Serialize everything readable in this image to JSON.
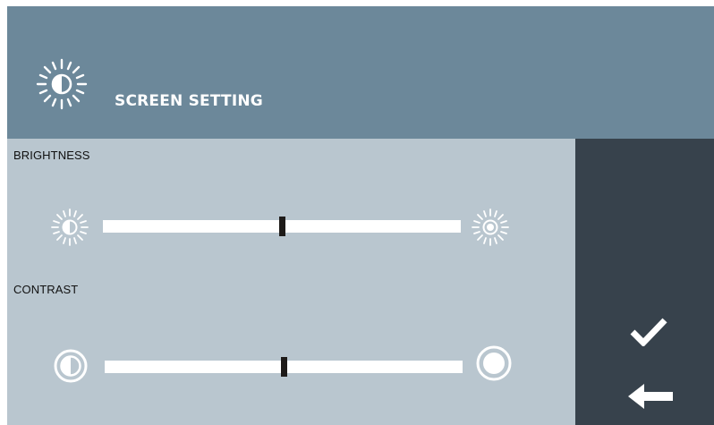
{
  "header": {
    "title": "SCREEN SETTING",
    "icon": "brightness-icon"
  },
  "brightness": {
    "label": "BRIGHTNESS",
    "level_percent": 50,
    "min_icon": "brightness-low-icon",
    "max_icon": "brightness-high-icon"
  },
  "contrast": {
    "label": "CONTRAST",
    "level_percent": 50,
    "min_icon": "contrast-low-icon",
    "max_icon": "contrast-high-icon"
  },
  "actions": {
    "confirm_icon": "checkmark-icon",
    "back_icon": "back-arrow-icon"
  },
  "colors": {
    "header_bg": "#6c889a",
    "content_bg": "#b9c6cf",
    "side_panel_bg": "#37424c",
    "track": "#ffffff",
    "thumb": "#1e1b19"
  }
}
